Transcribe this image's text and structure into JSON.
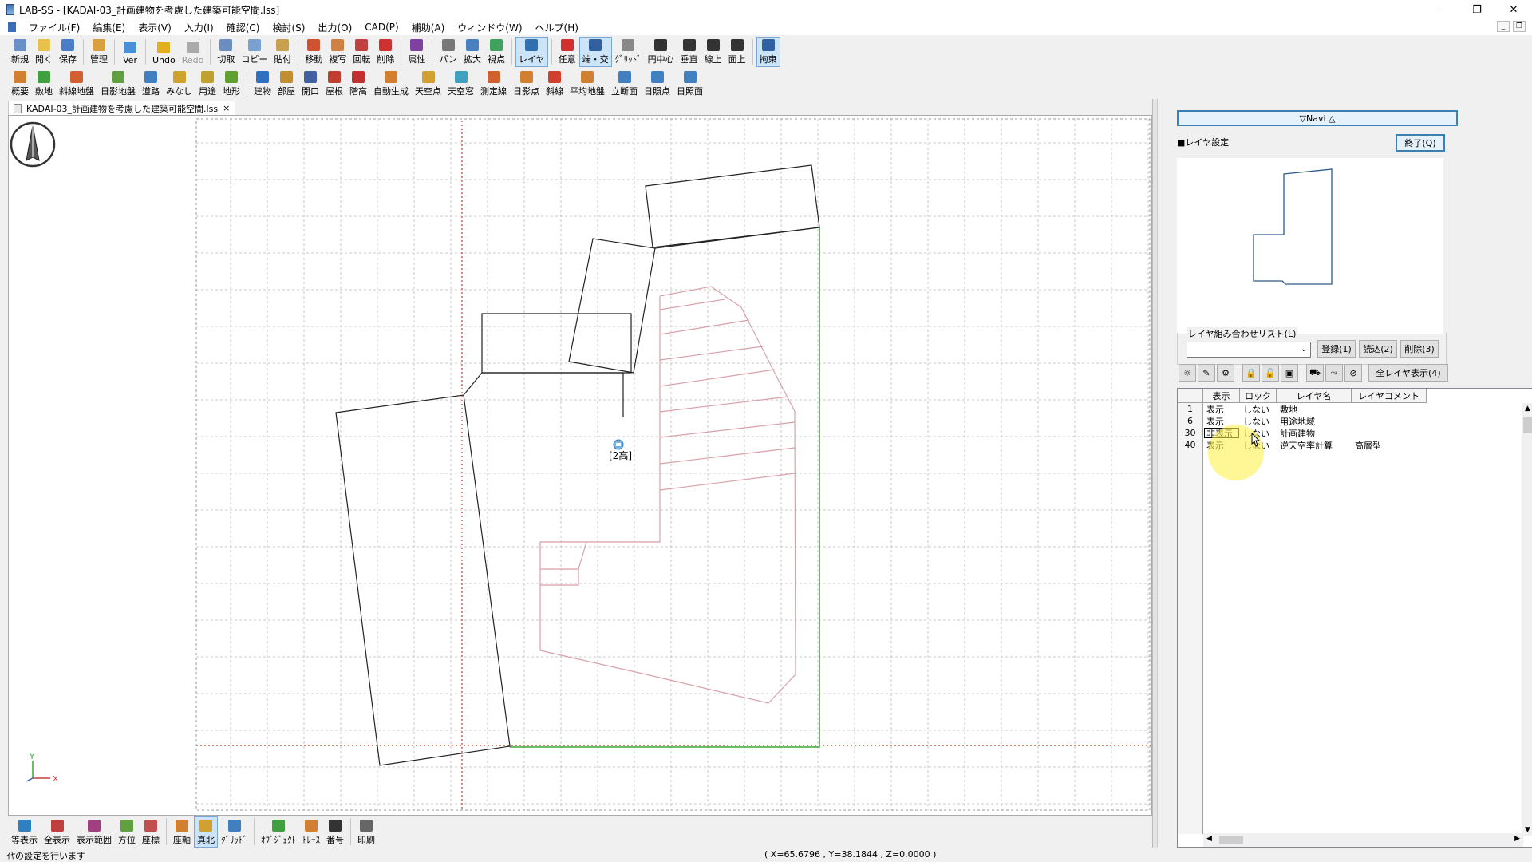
{
  "window": {
    "title": "LAB-SS - [KADAI-03_計画建物を考慮した建築可能空間.lss]",
    "controls": [
      "–",
      "❐",
      "✕"
    ]
  },
  "menu": [
    "ファイル(F)",
    "編集(E)",
    "表示(V)",
    "入力(I)",
    "確認(C)",
    "検討(S)",
    "出力(O)",
    "CAD(P)",
    "補助(A)",
    "ウィンドウ(W)",
    "ヘルプ(H)"
  ],
  "toolbar1": [
    {
      "label": "新規",
      "icon": "new-file-icon",
      "color": "#6b8fc7"
    },
    {
      "label": "開く",
      "icon": "open-folder-icon",
      "color": "#e8c14a"
    },
    {
      "label": "保存",
      "icon": "save-icon",
      "color": "#4a7cc7"
    },
    {
      "label": "管理",
      "icon": "manage-icon",
      "color": "#d9a040"
    },
    {
      "label": "Ver",
      "icon": "version-icon",
      "color": "#4a90d9"
    },
    {
      "label": "Undo",
      "icon": "undo-icon",
      "color": "#e0b020"
    },
    {
      "label": "Redo",
      "icon": "redo-icon",
      "color": "#aaaaaa",
      "disabled": true
    },
    {
      "label": "切取",
      "icon": "cut-icon",
      "color": "#6a8ec0"
    },
    {
      "label": "コピー",
      "icon": "copy-icon",
      "color": "#7aa0d0"
    },
    {
      "label": "貼付",
      "icon": "paste-icon",
      "color": "#c8a050"
    },
    {
      "label": "移動",
      "icon": "move-icon",
      "color": "#d05030"
    },
    {
      "label": "複写",
      "icon": "duplicate-icon",
      "color": "#d08040"
    },
    {
      "label": "回転",
      "icon": "rotate-icon",
      "color": "#c04040"
    },
    {
      "label": "削除",
      "icon": "delete-icon",
      "color": "#d03030"
    },
    {
      "label": "属性",
      "icon": "attribute-icon",
      "color": "#8040a0"
    },
    {
      "label": "パン",
      "icon": "pan-icon",
      "color": "#777777"
    },
    {
      "label": "拡大",
      "icon": "zoom-icon",
      "color": "#4a80c0"
    },
    {
      "label": "視点",
      "icon": "viewpoint-icon",
      "color": "#40a060"
    },
    {
      "label": "レイヤ",
      "icon": "layer-icon",
      "color": "#3070b0",
      "active": true
    },
    {
      "label": "任意",
      "icon": "arbitrary-snap-icon",
      "color": "#d03030"
    },
    {
      "label": "端・交",
      "icon": "endpoint-snap-icon",
      "color": "#3060a0",
      "active": true
    },
    {
      "label": "ｸﾞﾘｯﾄﾞ",
      "icon": "grid-snap-icon",
      "color": "#888888"
    },
    {
      "label": "円中心",
      "icon": "circle-center-icon",
      "color": "#333333"
    },
    {
      "label": "垂直",
      "icon": "perpendicular-icon",
      "color": "#333333"
    },
    {
      "label": "線上",
      "icon": "on-line-icon",
      "color": "#333333"
    },
    {
      "label": "面上",
      "icon": "on-face-icon",
      "color": "#333333"
    },
    {
      "label": "拘束",
      "icon": "constraint-icon",
      "color": "#3060a0",
      "active": true
    }
  ],
  "toolbar2": [
    {
      "label": "概要",
      "icon": "overview-icon",
      "color": "#d08030"
    },
    {
      "label": "敷地",
      "icon": "site-icon",
      "color": "#40a040"
    },
    {
      "label": "斜線地盤",
      "icon": "slope-ground-icon",
      "color": "#d06030"
    },
    {
      "label": "日影地盤",
      "icon": "shadow-ground-icon",
      "color": "#60a040"
    },
    {
      "label": "道路",
      "icon": "road-icon",
      "color": "#4080c0"
    },
    {
      "label": "みなし",
      "icon": "deemed-icon",
      "color": "#d0a030"
    },
    {
      "label": "用途",
      "icon": "use-zone-icon",
      "color": "#c0a030"
    },
    {
      "label": "地形",
      "icon": "terrain-icon",
      "color": "#60a030"
    },
    {
      "label": "建物",
      "icon": "building-icon",
      "color": "#3070c0"
    },
    {
      "label": "部屋",
      "icon": "room-icon",
      "color": "#c09030"
    },
    {
      "label": "開口",
      "icon": "opening-icon",
      "color": "#4060a0"
    },
    {
      "label": "屋根",
      "icon": "roof-icon",
      "color": "#c04030"
    },
    {
      "label": "階高",
      "icon": "floor-height-icon",
      "color": "#c03030"
    },
    {
      "label": "自動生成",
      "icon": "auto-generate-icon",
      "color": "#d08030"
    },
    {
      "label": "天空点",
      "icon": "sky-point-icon",
      "color": "#d0a030"
    },
    {
      "label": "天空窓",
      "icon": "sky-window-icon",
      "color": "#40a0c0"
    },
    {
      "label": "測定線",
      "icon": "measure-line-icon",
      "color": "#d06030"
    },
    {
      "label": "日影点",
      "icon": "shadow-point-icon",
      "color": "#d08030"
    },
    {
      "label": "斜線",
      "icon": "slope-line-icon",
      "color": "#d04030"
    },
    {
      "label": "平均地盤",
      "icon": "average-ground-icon",
      "color": "#d08030"
    },
    {
      "label": "立断面",
      "icon": "section-icon",
      "color": "#4080c0"
    },
    {
      "label": "日照点",
      "icon": "sunlight-point-icon",
      "color": "#4080c0"
    },
    {
      "label": "日照面",
      "icon": "sunlight-face-icon",
      "color": "#4080c0"
    }
  ],
  "doc_tab": {
    "label": "KADAI-03_計画建物を考慮した建築可能空間.lss",
    "close": "×"
  },
  "canvas": {
    "compass_label": "N",
    "building_label": "[2高]",
    "axis_y": "Y",
    "axis_x": "X",
    "colors": {
      "site": "#33aa33",
      "building": "#222222",
      "slope": "#d9a0a8",
      "gridline": "#c0c0c0",
      "origin": "#c04020"
    }
  },
  "bottom_toolbar": [
    {
      "label": "等表示",
      "icon": "equal-view-icon",
      "color": "#3080c0"
    },
    {
      "label": "全表示",
      "icon": "fit-all-icon",
      "color": "#c04040"
    },
    {
      "label": "表示範囲",
      "icon": "view-range-icon",
      "color": "#a04080"
    },
    {
      "label": "方位",
      "icon": "orientation-icon",
      "color": "#60a040"
    },
    {
      "label": "座標",
      "icon": "coordinates-icon",
      "color": "#c05050"
    },
    {
      "label": "座軸",
      "icon": "axis-icon",
      "color": "#d08030"
    },
    {
      "label": "真北",
      "icon": "true-north-icon",
      "color": "#d0a030",
      "active": true
    },
    {
      "label": "ｸﾞﾘｯﾄﾞ",
      "icon": "grid-icon",
      "color": "#4080c0"
    },
    {
      "label": "ｵﾌﾞｼﾞｪｸﾄ",
      "icon": "object-icon",
      "color": "#40a040"
    },
    {
      "label": "ﾄﾚｰｽ",
      "icon": "trace-icon",
      "color": "#d08030"
    },
    {
      "label": "番号",
      "icon": "number-icon",
      "color": "#333333"
    },
    {
      "label": "印刷",
      "icon": "print-icon",
      "color": "#666666"
    }
  ],
  "status": {
    "message": "ｲﾔの設定を行います",
    "coords": "( X=65.6796 , Y=38.1844 , Z=0.0000 )"
  },
  "panel": {
    "navi_label": "▽Navi △",
    "title": "■レイヤ設定",
    "end_button": "終了(Q)",
    "combo_label": "レイヤ組み合わせリスト(L)",
    "combo_value": "",
    "register_button": "登録(1)",
    "load_button": "読込(2)",
    "delete_button": "削除(3)",
    "show_all_button": "全レイヤ表示(4)",
    "icon_buttons": [
      "sun-icon",
      "pen-icon",
      "gear-icon",
      "lock-icon",
      "unlock-icon",
      "lock-all-icon",
      "truck-icon",
      "link-icon",
      "erase-icon"
    ],
    "grid": {
      "headers": [
        "表示",
        "ロック",
        "レイヤ名",
        "レイヤコメント"
      ],
      "rows": [
        {
          "num": "1",
          "display": "表示",
          "lock": "しない",
          "name": "敷地",
          "comment": ""
        },
        {
          "num": "6",
          "display": "表示",
          "lock": "しない",
          "name": "用途地域",
          "comment": ""
        },
        {
          "num": "30",
          "display": "非表示",
          "lock": "しない",
          "name": "計画建物",
          "comment": ""
        },
        {
          "num": "40",
          "display": "表示",
          "lock": "しない",
          "name": "逆天空率計算",
          "comment": "高層型"
        }
      ]
    }
  }
}
